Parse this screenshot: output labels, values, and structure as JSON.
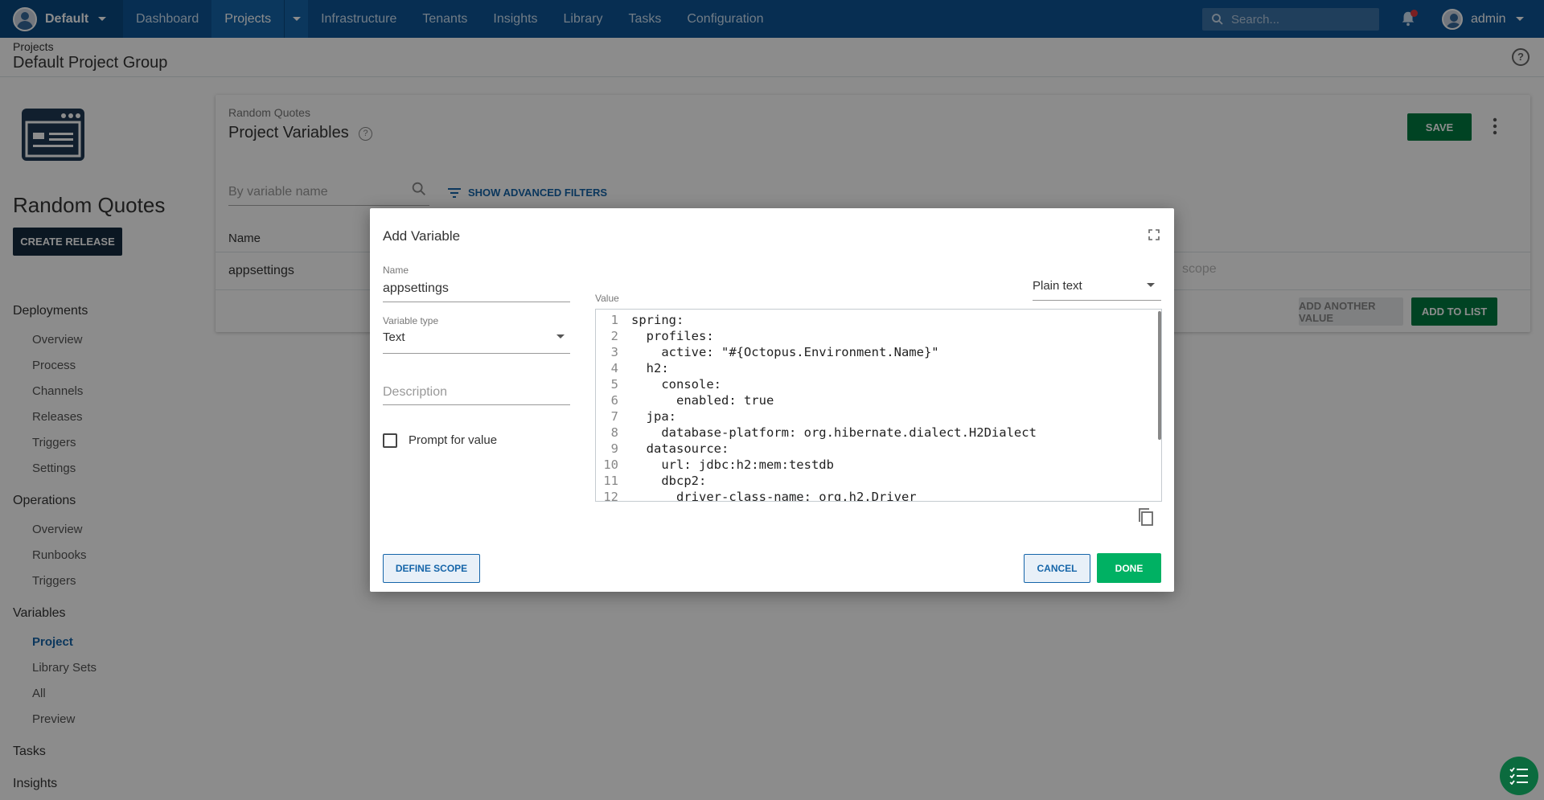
{
  "nav": {
    "space": "Default",
    "items": [
      "Dashboard",
      "Projects",
      "Infrastructure",
      "Tenants",
      "Insights",
      "Library",
      "Tasks",
      "Configuration"
    ],
    "search_placeholder": "Search...",
    "user": "admin"
  },
  "header": {
    "breadcrumb": "Projects",
    "title": "Default Project Group"
  },
  "sidebar": {
    "project_name": "Random Quotes",
    "create_release": "CREATE RELEASE",
    "groups": [
      {
        "title": "Deployments",
        "items": [
          "Overview",
          "Process",
          "Channels",
          "Releases",
          "Triggers",
          "Settings"
        ]
      },
      {
        "title": "Operations",
        "items": [
          "Overview",
          "Runbooks",
          "Triggers"
        ]
      },
      {
        "title": "Variables",
        "items": [
          "Project",
          "Library Sets",
          "All",
          "Preview"
        ]
      },
      {
        "title": "Tasks",
        "items": []
      },
      {
        "title": "Insights",
        "items": []
      }
    ]
  },
  "main": {
    "breadcrumb": "Random Quotes",
    "title": "Project Variables",
    "save": "SAVE",
    "filter_placeholder": "By variable name",
    "advanced_filters": "SHOW ADVANCED FILTERS",
    "col_name": "Name",
    "row_name": "appsettings",
    "row_scope_placeholder": "scope",
    "add_another": "ADD ANOTHER VALUE",
    "add_to_list": "ADD TO LIST"
  },
  "dialog": {
    "title": "Add Variable",
    "name_label": "Name",
    "name_value": "appsettings",
    "type_label": "Variable type",
    "type_value": "Text",
    "description_placeholder": "Description",
    "prompt_label": "Prompt for value",
    "value_label": "Value",
    "format_value": "Plain text",
    "code_lines": [
      {
        "n": "1",
        "t": "spring:"
      },
      {
        "n": "2",
        "t": "  profiles:"
      },
      {
        "n": "3",
        "t": "    active: \"#{Octopus.Environment.Name}\""
      },
      {
        "n": "4",
        "t": "  h2:"
      },
      {
        "n": "5",
        "t": "    console:"
      },
      {
        "n": "6",
        "t": "      enabled: true"
      },
      {
        "n": "7",
        "t": "  jpa:"
      },
      {
        "n": "8",
        "t": "    database-platform: org.hibernate.dialect.H2Dialect"
      },
      {
        "n": "9",
        "t": "  datasource:"
      },
      {
        "n": "10",
        "t": "    url: jdbc:h2:mem:testdb"
      },
      {
        "n": "11",
        "t": "    dbcp2:"
      },
      {
        "n": "12",
        "t": "      driver-class-name: org.h2.Driver"
      }
    ],
    "define_scope": "DEFINE SCOPE",
    "cancel": "CANCEL",
    "done": "DONE"
  }
}
